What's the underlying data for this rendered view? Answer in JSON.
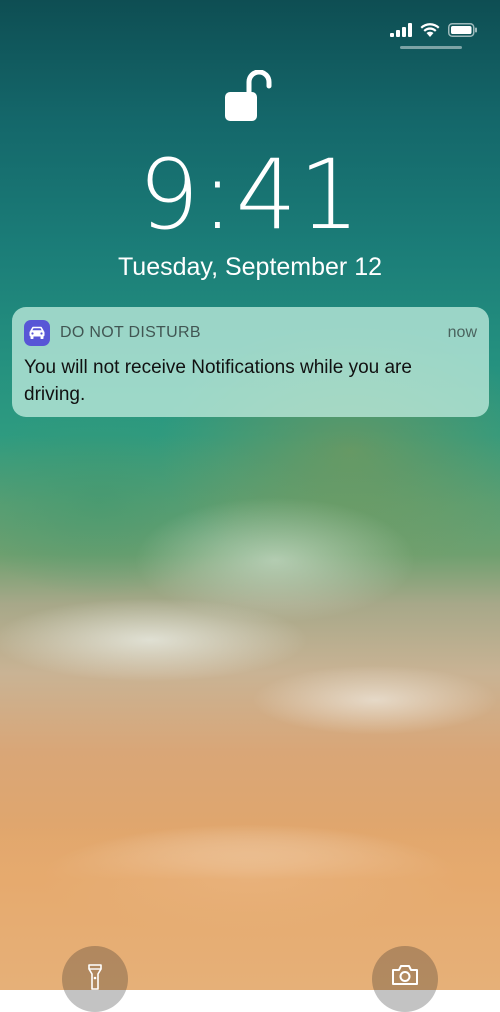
{
  "lockscreen": {
    "time": "9:41",
    "date": "Tuesday, September 12"
  },
  "status_bar": {
    "icons": [
      "cellular-signal-icon",
      "wifi-icon",
      "battery-icon"
    ]
  },
  "notification": {
    "app_name": "DO NOT DISTURB",
    "timestamp": "now",
    "message": "You will not receive Notifications while you are driving.",
    "app_icon": "car-icon",
    "icon_color": "#5856d6"
  },
  "bottom_controls": {
    "left_icon": "flashlight-icon",
    "right_icon": "camera-icon"
  }
}
